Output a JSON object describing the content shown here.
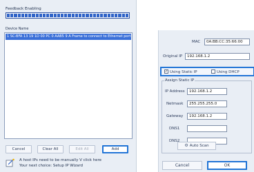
{
  "left_window": {
    "scan_label": "Feedback Enabling",
    "scan_segments": 34,
    "list_header": "Device Name",
    "device_row": "1  SC-BFA 13 19 1D 00 PC 0 AAB5 9 A  Frame to connect to Ethernet port  IP",
    "buttons": {
      "cancel": "Cancel",
      "clear_all": "Clear All",
      "edit": "Edit All",
      "add": "Add"
    },
    "hint_line1": "A host IPs need to be manually V click here",
    "hint_line2": "Your next choice: Setup IP Wizard",
    "hint_icon": "wizard-icon"
  },
  "dialog": {
    "mac_label": "MAC",
    "mac_value": "0A:BB:CC:35:66:00",
    "original_ip_label": "Original IP",
    "original_ip_value": "192.168.1.2",
    "use_static_ip": "Using Static IP",
    "use_dhcp": "Using DHCP",
    "static_checked": "✓",
    "assign_group": "Assign Static IP",
    "ip_label": "IP Address",
    "ip_value": "192.168.1.2",
    "netmask_label": "Netmask",
    "netmask_value": "255.255.255.0",
    "gateway_label": "Gateway",
    "gateway_value": "192.168.1.2",
    "dns1_label": "DNS1",
    "dns1_value": "",
    "dns2_label": "DNS2",
    "dns2_value": "",
    "auto_scan": "Auto Scan",
    "cancel": "Cancel",
    "ok": "OK"
  },
  "colors": {
    "accent": "#1f73d6",
    "selection": "#3a6fd8",
    "panel": "#e9eef5"
  }
}
